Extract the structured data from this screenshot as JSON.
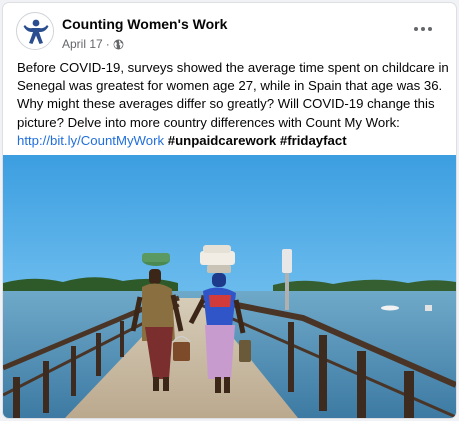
{
  "page": {
    "name": "Counting Women's Work"
  },
  "post": {
    "date": "April 17",
    "separator": "·",
    "privacy_icon": "globe-icon",
    "more_icon": "more-options-icon",
    "text": "Before COVID-19, surveys showed the average time spent on childcare in Senegal was greatest for women age 27, while in Spain that age was 36. Why might these averages differ so greatly? Will COVID-19 change this picture? Delve into more country differences with Count My Work:",
    "link": "http://bit.ly/CountMyWork",
    "hashtags": [
      "#unpaidcarework",
      "#fridayfact"
    ]
  },
  "colors": {
    "link": "#216fdb",
    "secondary_text": "#65676b",
    "logo": "#2a4e8f"
  }
}
